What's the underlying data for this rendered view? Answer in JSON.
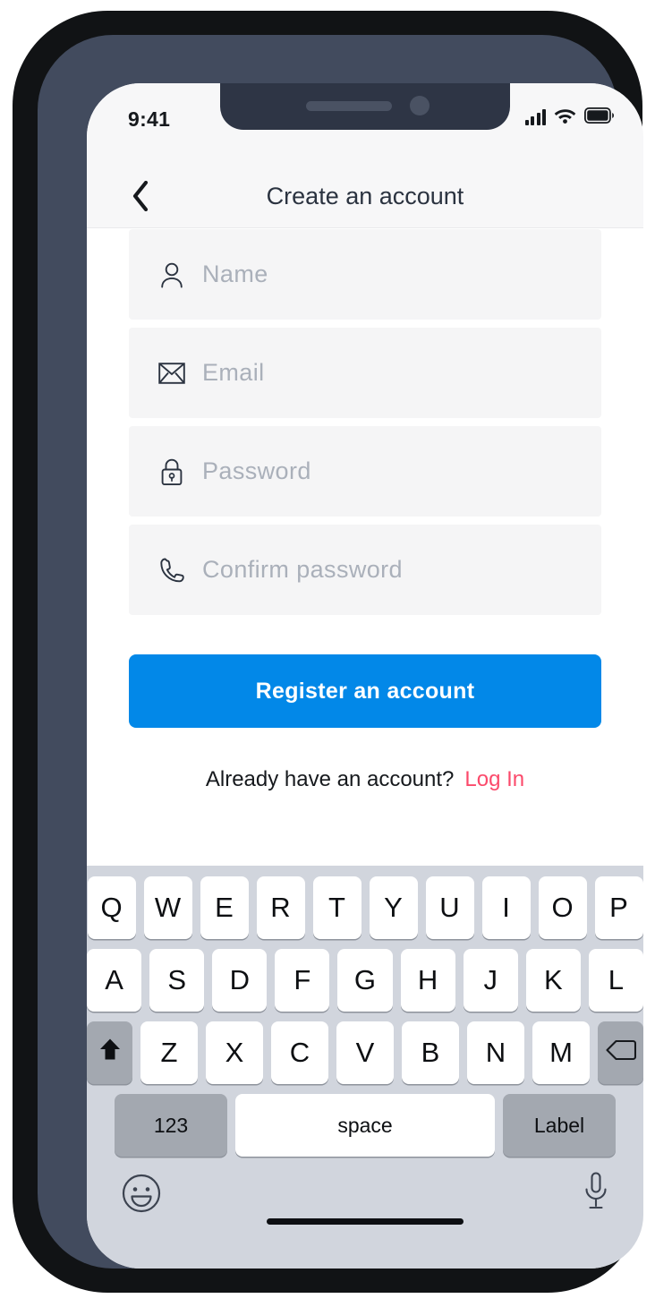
{
  "status_bar": {
    "time": "9:41",
    "cellular_icon": "cellular-bars-icon",
    "wifi_icon": "wifi-icon",
    "battery_icon": "battery-full-icon"
  },
  "header": {
    "back_icon": "chevron-left-icon",
    "title": "Create an account"
  },
  "form": {
    "fields": [
      {
        "name": "name",
        "placeholder": "Name",
        "icon": "user-icon"
      },
      {
        "name": "email",
        "placeholder": "Email",
        "icon": "envelope-icon"
      },
      {
        "name": "password",
        "placeholder": "Password",
        "icon": "lock-icon"
      },
      {
        "name": "confirm_password",
        "placeholder": "Confirm password",
        "icon": "phone-handset-icon"
      }
    ],
    "submit_label": "Register an account",
    "footer_text": "Already have an account?",
    "login_label": "Log In"
  },
  "colors": {
    "primary_button": "#0288e8",
    "login_link": "#fb4a6b",
    "field_background": "#f5f5f6",
    "keyboard_background": "#d1d5dd",
    "frame_outer": "#111315",
    "frame_inner": "#424b5e"
  },
  "keyboard": {
    "row1": [
      "Q",
      "W",
      "E",
      "R",
      "T",
      "Y",
      "U",
      "I",
      "O",
      "P"
    ],
    "row2": [
      "A",
      "S",
      "D",
      "F",
      "G",
      "H",
      "J",
      "K",
      "L"
    ],
    "row3": [
      "Z",
      "X",
      "C",
      "V",
      "B",
      "N",
      "M"
    ],
    "shift_icon": "shift-up-arrow-icon",
    "backspace_icon": "backspace-delete-icon",
    "numeric_label": "123",
    "space_label": "space",
    "return_label": "Label",
    "emoji_icon": "smiley-face-icon",
    "mic_icon": "microphone-icon"
  }
}
